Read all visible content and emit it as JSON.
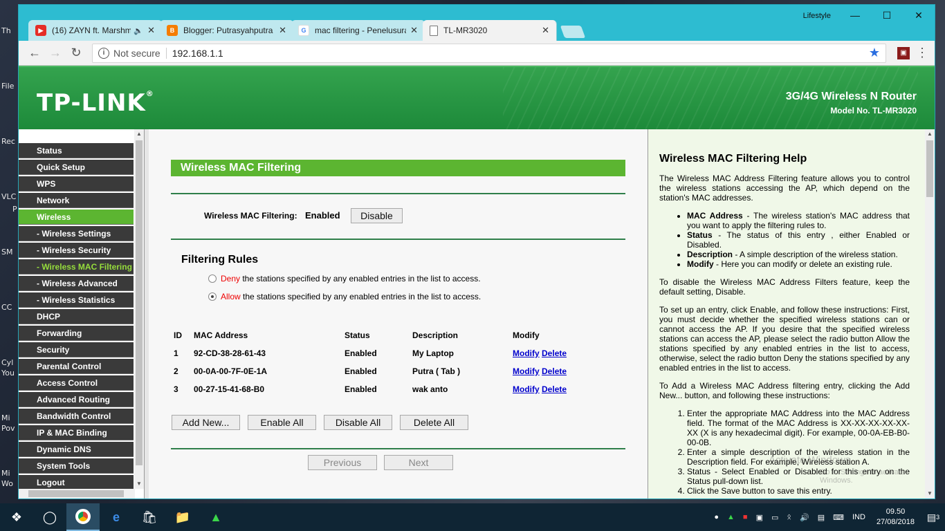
{
  "desktop": {
    "labels": [
      "Th",
      "File",
      "Rec",
      "VLC",
      "P",
      "SM",
      "CC",
      "Cyl",
      "You",
      "Mi",
      "Pov",
      "Mi",
      "Wo"
    ]
  },
  "browser": {
    "profile": "Lifestyle",
    "tabs": [
      {
        "title": "(16) ZAYN ft. Marshm",
        "icon": "youtube-icon",
        "color": "#e52d27"
      },
      {
        "title": "Blogger: Putrasyahputra",
        "icon": "blogger-icon",
        "color": "#f57d00"
      },
      {
        "title": "mac filtering - Penelusuran",
        "icon": "google-icon",
        "color": "#4285f4"
      },
      {
        "title": "TL-MR3020",
        "icon": "page-icon",
        "color": "#ffffff"
      }
    ],
    "address": {
      "security": "Not secure",
      "url": "192.168.1.1"
    }
  },
  "banner": {
    "logo": "TP-LINK",
    "product": "3G/4G Wireless N Router",
    "model": "Model No. TL-MR3020"
  },
  "menu": [
    {
      "label": "Status"
    },
    {
      "label": "Quick Setup"
    },
    {
      "label": "WPS"
    },
    {
      "label": "Network"
    },
    {
      "label": "Wireless"
    },
    {
      "label": "- Wireless Settings"
    },
    {
      "label": "- Wireless Security"
    },
    {
      "label": "- Wireless MAC Filtering"
    },
    {
      "label": "- Wireless Advanced"
    },
    {
      "label": "- Wireless Statistics"
    },
    {
      "label": "DHCP"
    },
    {
      "label": "Forwarding"
    },
    {
      "label": "Security"
    },
    {
      "label": "Parental Control"
    },
    {
      "label": "Access Control"
    },
    {
      "label": "Advanced Routing"
    },
    {
      "label": "Bandwidth Control"
    },
    {
      "label": "IP & MAC Binding"
    },
    {
      "label": "Dynamic DNS"
    },
    {
      "label": "System Tools"
    },
    {
      "label": "Logout"
    }
  ],
  "main": {
    "section_title": "Wireless MAC Filtering",
    "filter_label": "Wireless MAC Filtering:",
    "filter_status": "Enabled",
    "disable_button": "Disable",
    "rules_title": "Filtering Rules",
    "deny_word": "Deny",
    "deny_text": " the stations specified by any enabled entries in the list to access.",
    "allow_word": "Allow",
    "allow_text": " the stations specified by any enabled entries in the list to access.",
    "selected_rule": "allow",
    "table": {
      "headers": [
        "ID",
        "MAC Address",
        "Status",
        "Description",
        "Modify"
      ],
      "rows": [
        {
          "id": "1",
          "mac": "92-CD-38-28-61-43",
          "status": "Enabled",
          "desc": "My Laptop",
          "modify": "Modify",
          "delete": "Delete"
        },
        {
          "id": "2",
          "mac": "00-0A-00-7F-0E-1A",
          "status": "Enabled",
          "desc": "Putra ( Tab )",
          "modify": "Modify",
          "delete": "Delete"
        },
        {
          "id": "3",
          "mac": "00-27-15-41-68-B0",
          "status": "Enabled",
          "desc": "wak anto",
          "modify": "Modify",
          "delete": "Delete"
        }
      ]
    },
    "buttons": {
      "add_new": "Add New...",
      "enable_all": "Enable All",
      "disable_all": "Disable All",
      "delete_all": "Delete All",
      "previous": "Previous",
      "next": "Next"
    }
  },
  "help": {
    "title": "Wireless MAC Filtering Help",
    "intro": "The Wireless MAC Address Filtering feature allows you to control the wireless stations accessing the AP, which depend on the station's MAC addresses.",
    "bullets": [
      {
        "term": "MAC Address",
        "text": " - The wireless station's MAC address that you want to apply the filtering rules to."
      },
      {
        "term": "Status",
        "text": " - The status of this entry , either Enabled or Disabled."
      },
      {
        "term": "Description",
        "text": " - A simple description of the wireless station."
      },
      {
        "term": "Modify",
        "text": " - Here you can modify or delete an existing rule."
      }
    ],
    "disable_para": "To disable the Wireless MAC Address Filters feature, keep the default setting, Disable.",
    "setup_para": "To set up an entry, click Enable, and follow these instructions: First, you must decide whether the specified wireless stations can or cannot access the AP. If you desire that the specified wireless stations can access the AP, please select the radio button Allow the stations specified by any enabled entries in the list to access, otherwise, select the radio button Deny the stations specified by any enabled entries in the list to access.",
    "add_para": "To Add a Wireless MAC Address filtering entry, clicking the Add New... button, and following these instructions:",
    "steps": [
      "Enter the appropriate MAC Address into the MAC Address field. The format of the MAC Address is XX-XX-XX-XX-XX-XX (X is any hexadecimal digit). For example, 00-0A-EB-B0-00-0B.",
      "Enter a simple description of the wireless station in the Description field. For example, Wireless station A.",
      "Status - Select Enabled or Disabled for this entry on the Status pull-down list.",
      "Click the Save button to save this entry."
    ],
    "watermark": "Activate Windows",
    "watermark_sub": "Go to Settings to activate Windows."
  },
  "taskbar": {
    "lang": "IND",
    "time": "09.50",
    "date": "27/08/2018",
    "notifications": "3"
  }
}
